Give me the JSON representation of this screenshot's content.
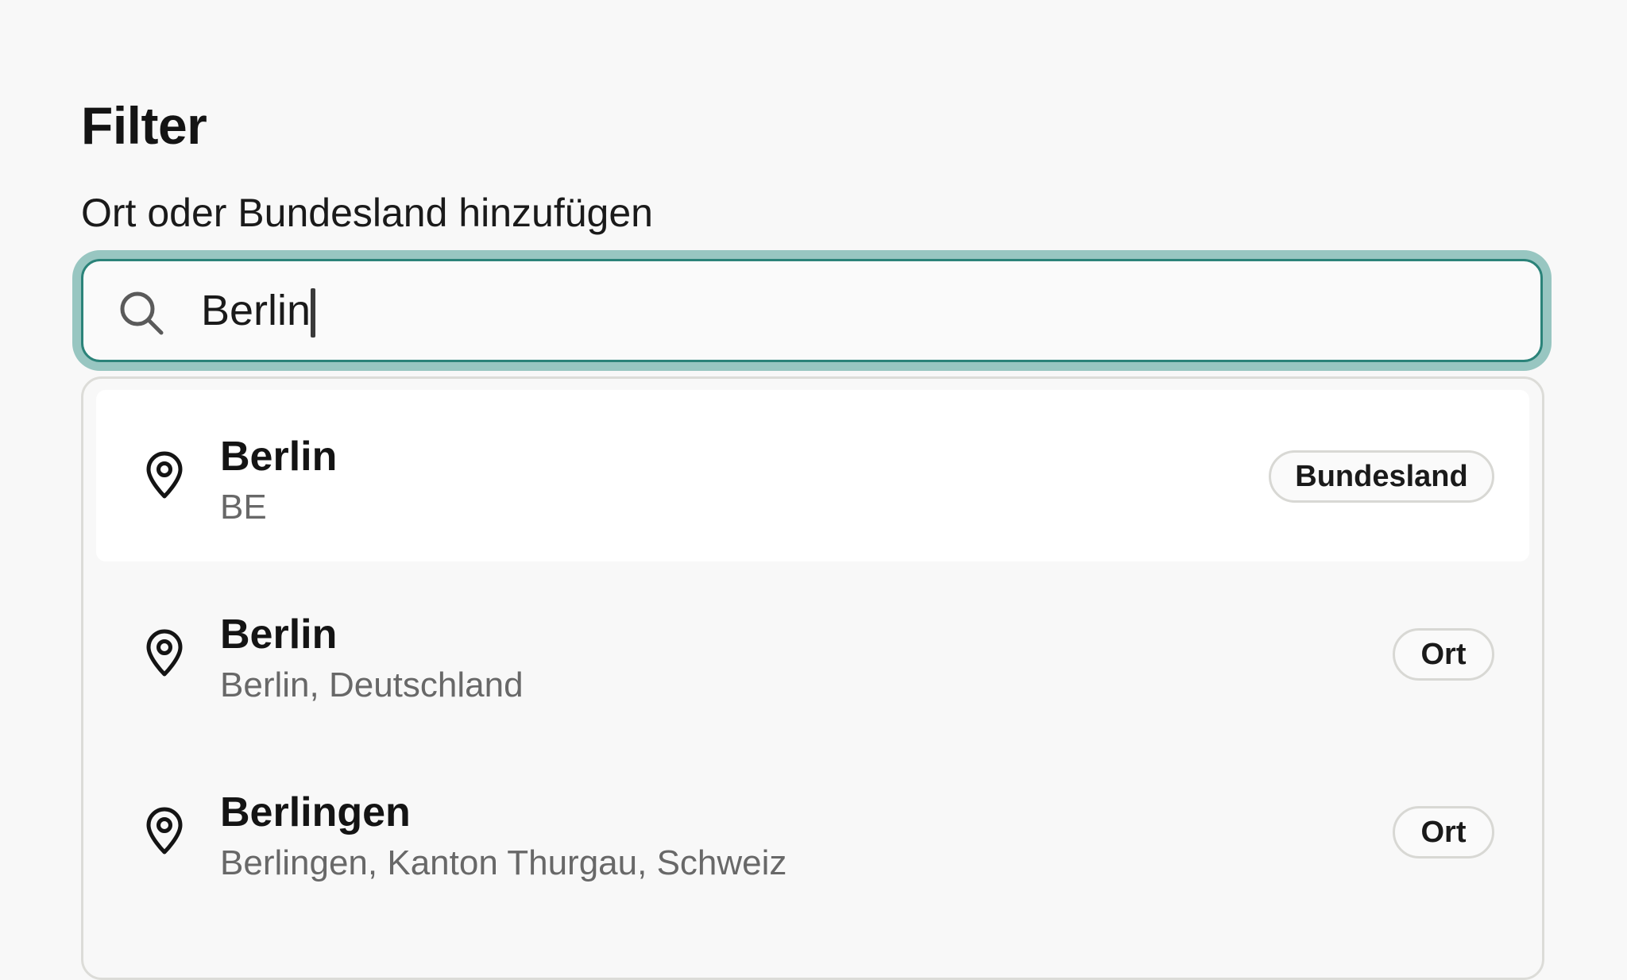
{
  "header": {
    "title": "Filter"
  },
  "location_filter": {
    "label": "Ort oder Bundesland hinzufügen",
    "input_value": "Berlin",
    "search_icon": "search-icon",
    "focus_ring_color": "#5ea89f",
    "border_color": "#2b8379"
  },
  "suggestions": [
    {
      "title": "Berlin",
      "subtitle": "BE",
      "badge": "Bundesland",
      "icon": "map-pin-icon",
      "highlighted": true
    },
    {
      "title": "Berlin",
      "subtitle": "Berlin, Deutschland",
      "badge": "Ort",
      "icon": "map-pin-icon",
      "highlighted": false
    },
    {
      "title": "Berlingen",
      "subtitle": "Berlingen, Kanton Thurgau, Schweiz",
      "badge": "Ort",
      "icon": "map-pin-icon",
      "highlighted": false
    }
  ]
}
